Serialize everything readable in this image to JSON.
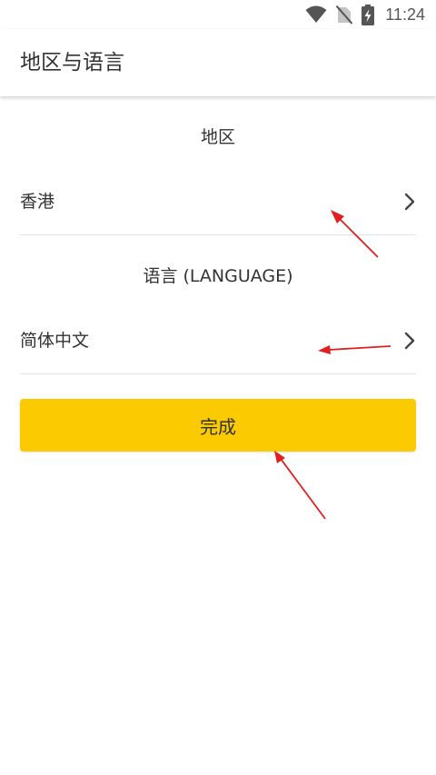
{
  "status_bar": {
    "time": "11:24",
    "icons": [
      "wifi-icon",
      "no-sim-icon",
      "battery-charging-icon"
    ]
  },
  "app_bar": {
    "title": "地区与语言"
  },
  "region": {
    "heading": "地区",
    "value": "香港"
  },
  "language": {
    "heading": "语言 (LANGUAGE)",
    "value": "简体中文"
  },
  "done_button": {
    "label": "完成"
  },
  "colors": {
    "accent": "#fcca00",
    "annotation_arrow": "#e02020",
    "text": "#333333",
    "divider": "#e2e2e2"
  }
}
